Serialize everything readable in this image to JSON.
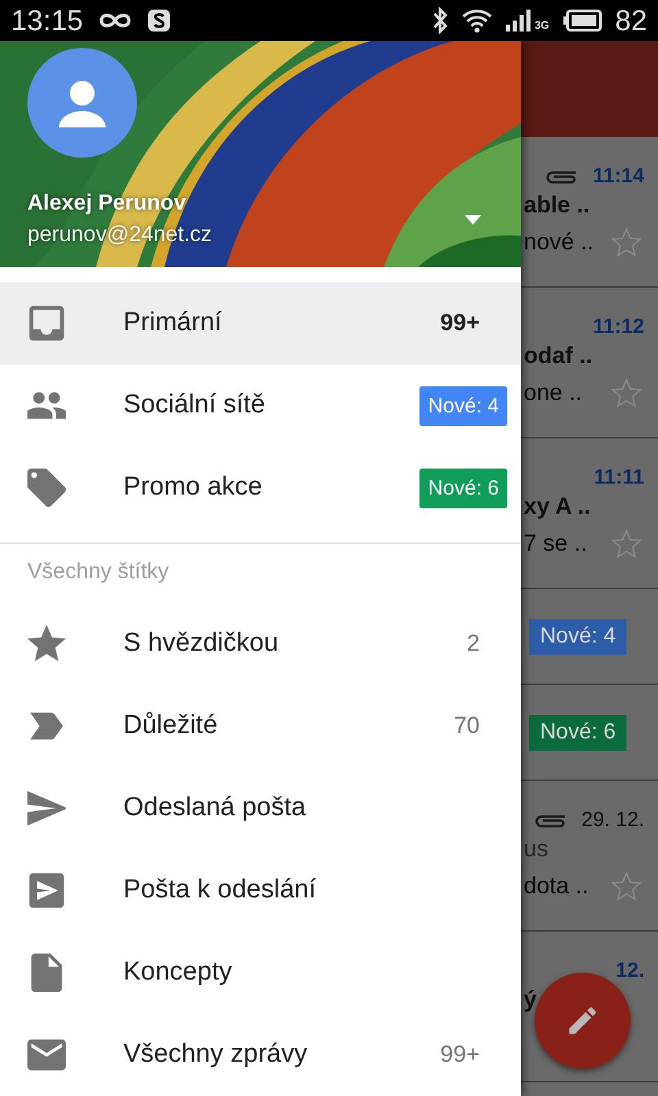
{
  "status_bar": {
    "time": "13:15",
    "network": "3G",
    "battery": "82"
  },
  "account": {
    "name": "Alexej Perunov",
    "email": "perunov@24net.cz"
  },
  "drawer": {
    "items": [
      {
        "label": "Primární",
        "kind": "count",
        "count": "99+",
        "selected": true
      },
      {
        "label": "Sociální sítě",
        "kind": "badge",
        "badge": "Nové: 4",
        "color": "#4285f4",
        "selected": false
      },
      {
        "label": "Promo akce",
        "kind": "badge",
        "badge": "Nové: 6",
        "color": "#0f9d58",
        "selected": false
      }
    ],
    "section_title": "Všechny štítky",
    "labels": [
      {
        "label": "S hvězdičkou",
        "kind": "count",
        "count": "2",
        "selected": false
      },
      {
        "label": "Důležité",
        "kind": "count",
        "count": "70",
        "selected": false
      },
      {
        "label": "Odeslaná pošta",
        "kind": "plain",
        "selected": false
      },
      {
        "label": "Pošta k odeslání",
        "kind": "plain",
        "selected": false
      },
      {
        "label": "Koncepty",
        "kind": "plain",
        "selected": false
      },
      {
        "label": "Všechny zprávy",
        "kind": "count",
        "count": "99+",
        "selected": false
      }
    ]
  },
  "mail_list": [
    {
      "kind": "mail",
      "time": "11:14",
      "unread": true,
      "attachment": true,
      "subject": "able ..",
      "snippet": "nové ..",
      "starred": false
    },
    {
      "kind": "mail",
      "time": "11:12",
      "unread": true,
      "attachment": false,
      "subject": "odaf ..",
      "snippet": "one ..",
      "starred": false
    },
    {
      "kind": "mail",
      "time": "11:11",
      "unread": true,
      "attachment": false,
      "subject": "xy A ..",
      "snippet": "7 se ..",
      "starred": false
    },
    {
      "kind": "category",
      "badge": "Nové: 4",
      "color": "#2d5ca8"
    },
    {
      "kind": "category",
      "badge": "Nové: 6",
      "color": "#0b6b3c"
    },
    {
      "kind": "mail",
      "time": "29. 12.",
      "unread": false,
      "attachment": true,
      "subject": "us",
      "snippet": "dota ..",
      "starred": false
    },
    {
      "kind": "mail",
      "time": "12.",
      "unread": true,
      "attachment": false,
      "subject": "ý"
    }
  ]
}
